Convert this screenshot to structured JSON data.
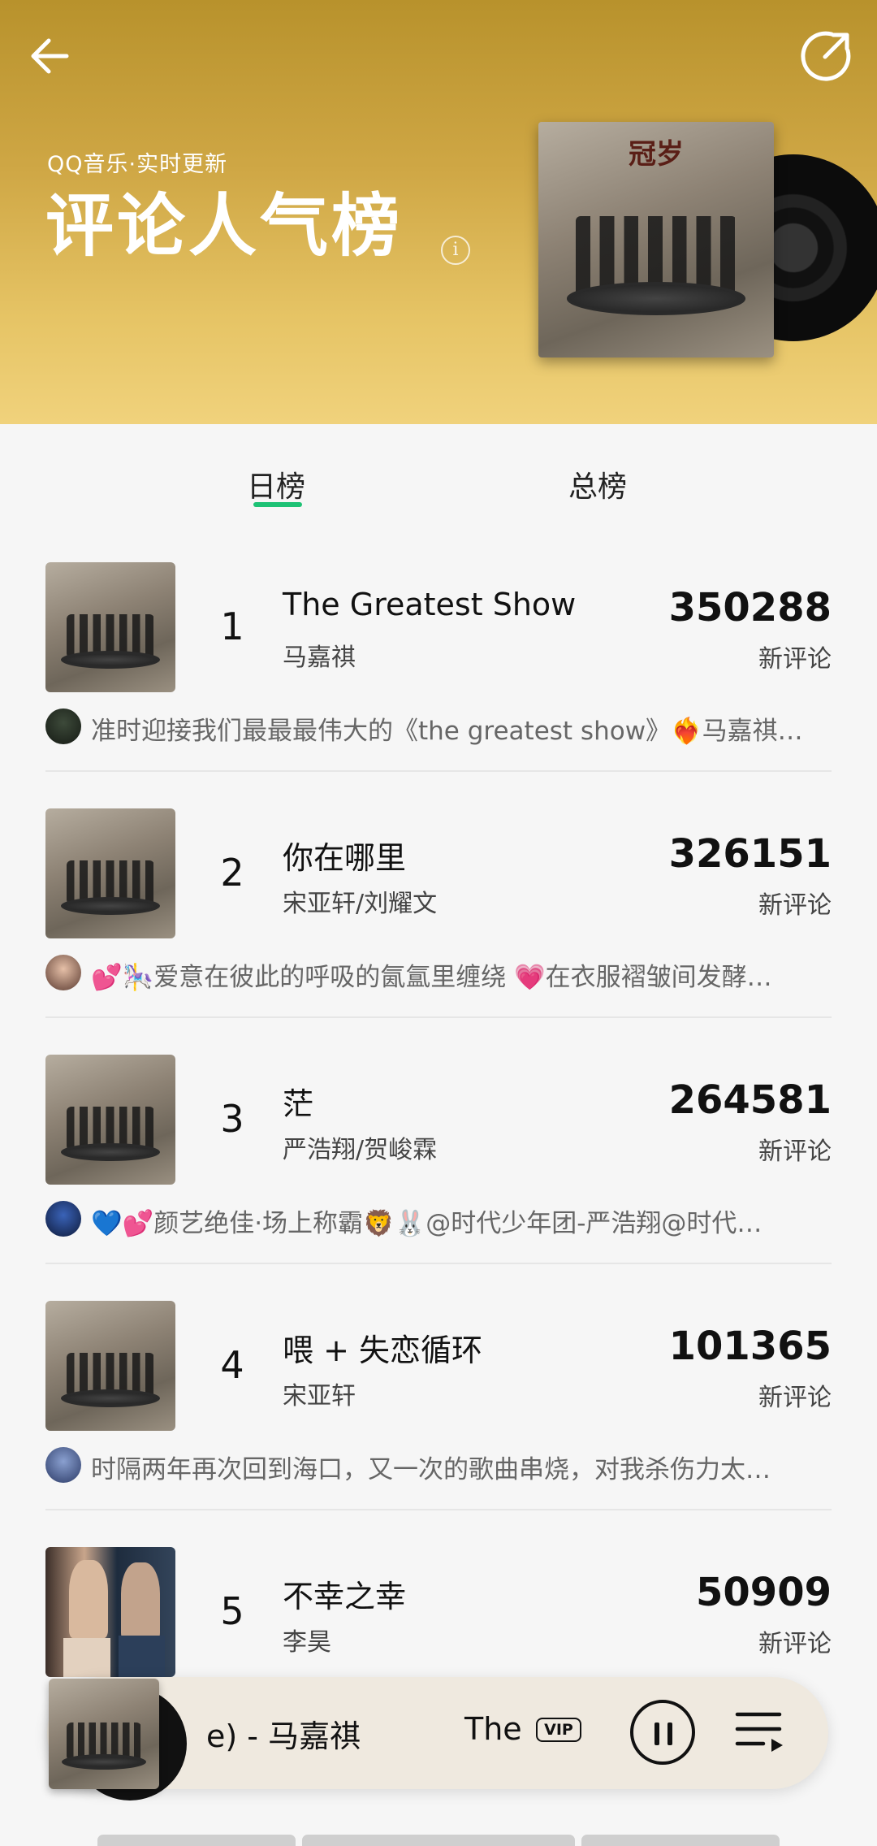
{
  "header": {
    "subtitle": "QQ音乐·实时更新",
    "title": "评论人气榜",
    "info_icon": "info-icon",
    "back_icon": "back-arrow-icon",
    "share_icon": "share-icon",
    "colors": {
      "gradient_top": "#b8922c",
      "gradient_bottom": "#f0d27c"
    },
    "cover_glyph": "冠岁"
  },
  "tabs": [
    {
      "label": "日榜",
      "active": true
    },
    {
      "label": "总榜",
      "active": false
    }
  ],
  "accent_color": "#1ec275",
  "chart_rows": [
    {
      "rank": "1",
      "title": "The Greatest Show",
      "artist": "马嘉祺",
      "count": "350288",
      "count_label": "新评论",
      "comment": "准时迎接我们最最最伟大的《the greatest show》❤️‍🔥马嘉祺…"
    },
    {
      "rank": "2",
      "title": "你在哪里",
      "artist": "宋亚轩/刘耀文",
      "count": "326151",
      "count_label": "新评论",
      "comment": "💕🎠爱意在彼此的呼吸的氤氲里缠绕 💗在衣服褶皱间发酵…"
    },
    {
      "rank": "3",
      "title": "茫",
      "artist": "严浩翔/贺峻霖",
      "count": "264581",
      "count_label": "新评论",
      "comment": "💙💕颜艺绝佳·场上称霸🦁🐰@时代少年团-严浩翔@时代…"
    },
    {
      "rank": "4",
      "title": "喂 + 失恋循环",
      "artist": "宋亚轩",
      "count": "101365",
      "count_label": "新评论",
      "comment": "时隔两年再次回到海口，又一次的歌曲串烧，对我杀伤力太…"
    },
    {
      "rank": "5",
      "title": "不幸之幸",
      "artist": "李昊",
      "count": "50909",
      "count_label": "新评论",
      "comment": ""
    }
  ],
  "player": {
    "song_text": "e) - 马嘉祺",
    "next_text": "The",
    "vip_label": "VIP",
    "pause_icon": "pause-icon",
    "playlist_icon": "playlist-icon"
  }
}
